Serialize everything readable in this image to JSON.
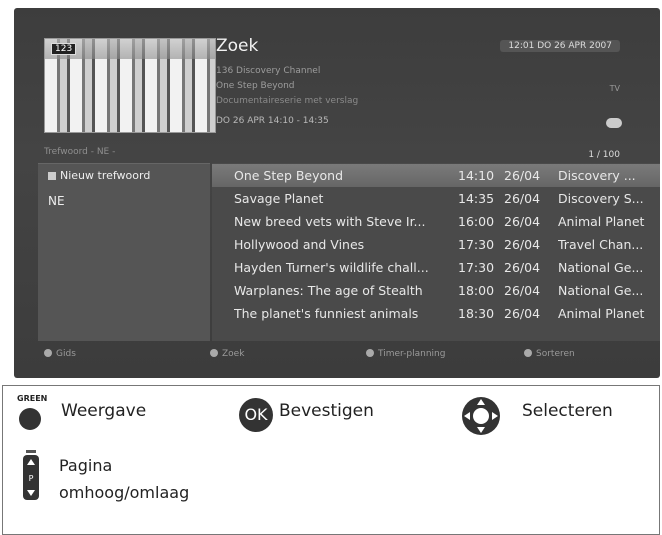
{
  "tv": {
    "channel_badge": "123",
    "title": "Zoek",
    "clock": "12:01  DO 26 APR 2007",
    "info": {
      "channel": "136 Discovery Channel",
      "program": "One Step Beyond",
      "description": "Documentaireserie met verslag",
      "tv_tag": "TV",
      "datetime": "DO 26 APR 14:10 - 14:35"
    },
    "keyword_header": "Trefwoord - NE -",
    "page_count": "1 / 100",
    "sidebar": {
      "items": [
        {
          "label": "Nieuw trefwoord"
        },
        {
          "label": "NE"
        }
      ]
    },
    "results": [
      {
        "title": "One Step Beyond",
        "time": "14:10",
        "date": "26/04",
        "channel": "Discovery ..."
      },
      {
        "title": "Savage Planet",
        "time": "14:35",
        "date": "26/04",
        "channel": "Discovery S..."
      },
      {
        "title": "New breed vets with Steve Ir...",
        "time": "16:00",
        "date": "26/04",
        "channel": "Animal Planet"
      },
      {
        "title": "Hollywood and Vines",
        "time": "17:30",
        "date": "26/04",
        "channel": "Travel Chan..."
      },
      {
        "title": "Hayden Turner's wildlife chall...",
        "time": "17:30",
        "date": "26/04",
        "channel": "National Ge..."
      },
      {
        "title": "Warplanes: The age of Stealth",
        "time": "18:00",
        "date": "26/04",
        "channel": "National Ge..."
      },
      {
        "title": "The planet's funniest animals",
        "time": "18:30",
        "date": "26/04",
        "channel": "Animal Planet"
      }
    ],
    "legend": [
      "Gids",
      "Zoek",
      "Timer-planning",
      "Sorteren"
    ]
  },
  "instructions": {
    "green_label": "GREEN",
    "weergave": "Weergave",
    "ok": "OK",
    "bevestigen": "Bevestigen",
    "selecteren": "Selecteren",
    "pagina": "Pagina",
    "omhoog": "omhoog/omlaag",
    "page_letter": "P"
  }
}
